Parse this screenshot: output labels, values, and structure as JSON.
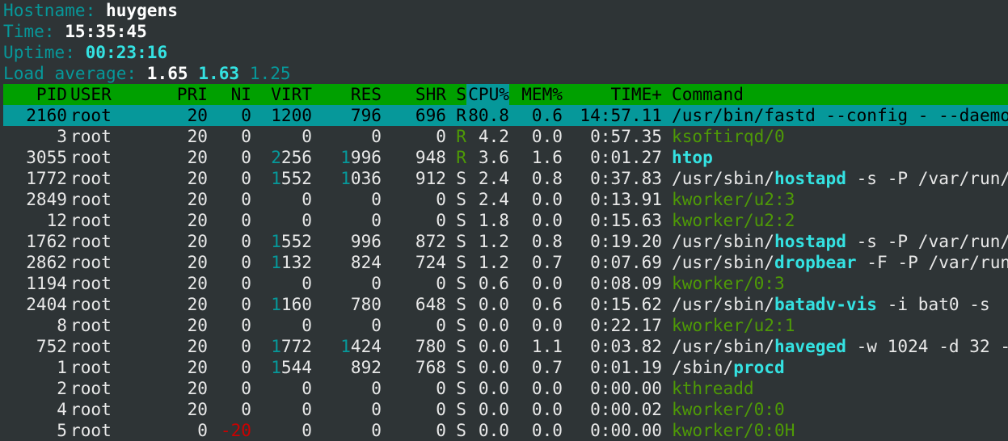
{
  "info": {
    "hostname_label": "Hostname:",
    "hostname": "huygens",
    "time_label": "Time:",
    "time": "15:35:45",
    "uptime_label": "Uptime:",
    "uptime": "00:23:16",
    "load_label": "Load average:",
    "load1": "1.65",
    "load5": "1.63",
    "load15": "1.25"
  },
  "columns": {
    "pid": "PID",
    "user": "USER",
    "pri": "PRI",
    "ni": "NI",
    "virt": "VIRT",
    "res": "RES",
    "shr": "SHR",
    "s": "S",
    "cpu": "CPU%",
    "mem": "MEM%",
    "time": "TIME+",
    "cmd": "Command"
  },
  "processes": [
    {
      "pid": "2160",
      "user": "root",
      "pri": "20",
      "ni": "0",
      "virt": "1200",
      "res": "796",
      "shr": "696",
      "s": "R",
      "cpu": "80.8",
      "mem": "0.6",
      "time": "14:57.11",
      "cmd_pre": "/usr/bin/fastd --config - --daemo",
      "cmd_bin": "",
      "cmd_post": ""
    },
    {
      "pid": "3",
      "user": "root",
      "pri": "20",
      "ni": "0",
      "virt": "0",
      "res": "0",
      "shr": "0",
      "s": "R",
      "cpu": "4.2",
      "mem": "0.0",
      "time": "0:57.35",
      "cmd_pre": "",
      "cmd_bin": "",
      "cmd_post": "",
      "kthread": "ksoftirqd/0"
    },
    {
      "pid": "3055",
      "user": "root",
      "pri": "20",
      "ni": "0",
      "virt": "2256",
      "res": "1996",
      "shr": "948",
      "s": "R",
      "cpu": "3.6",
      "mem": "1.6",
      "time": "0:01.27",
      "cmd_pre": "",
      "cmd_bin": "htop",
      "cmd_post": ""
    },
    {
      "pid": "1772",
      "user": "root",
      "pri": "20",
      "ni": "0",
      "virt": "1552",
      "res": "1036",
      "shr": "912",
      "s": "S",
      "cpu": "2.4",
      "mem": "0.8",
      "time": "0:37.83",
      "cmd_pre": "/usr/sbin/",
      "cmd_bin": "hostapd",
      "cmd_post": " -s -P /var/run/"
    },
    {
      "pid": "2849",
      "user": "root",
      "pri": "20",
      "ni": "0",
      "virt": "0",
      "res": "0",
      "shr": "0",
      "s": "S",
      "cpu": "2.4",
      "mem": "0.0",
      "time": "0:13.91",
      "kthread": "kworker/u2:3"
    },
    {
      "pid": "12",
      "user": "root",
      "pri": "20",
      "ni": "0",
      "virt": "0",
      "res": "0",
      "shr": "0",
      "s": "S",
      "cpu": "1.8",
      "mem": "0.0",
      "time": "0:15.63",
      "kthread": "kworker/u2:2"
    },
    {
      "pid": "1762",
      "user": "root",
      "pri": "20",
      "ni": "0",
      "virt": "1552",
      "res": "996",
      "shr": "872",
      "s": "S",
      "cpu": "1.2",
      "mem": "0.8",
      "time": "0:19.20",
      "cmd_pre": "/usr/sbin/",
      "cmd_bin": "hostapd",
      "cmd_post": " -s -P /var/run/"
    },
    {
      "pid": "2862",
      "user": "root",
      "pri": "20",
      "ni": "0",
      "virt": "1132",
      "res": "824",
      "shr": "724",
      "s": "S",
      "cpu": "1.2",
      "mem": "0.7",
      "time": "0:07.69",
      "cmd_pre": "/usr/sbin/",
      "cmd_bin": "dropbear",
      "cmd_post": " -F -P /var/run"
    },
    {
      "pid": "1194",
      "user": "root",
      "pri": "20",
      "ni": "0",
      "virt": "0",
      "res": "0",
      "shr": "0",
      "s": "S",
      "cpu": "0.6",
      "mem": "0.0",
      "time": "0:08.09",
      "kthread": "kworker/0:3"
    },
    {
      "pid": "2404",
      "user": "root",
      "pri": "20",
      "ni": "0",
      "virt": "1160",
      "res": "780",
      "shr": "648",
      "s": "S",
      "cpu": "0.0",
      "mem": "0.6",
      "time": "0:15.62",
      "cmd_pre": "/usr/sbin/",
      "cmd_bin": "batadv-vis",
      "cmd_post": " -i bat0 -s"
    },
    {
      "pid": "8",
      "user": "root",
      "pri": "20",
      "ni": "0",
      "virt": "0",
      "res": "0",
      "shr": "0",
      "s": "S",
      "cpu": "0.0",
      "mem": "0.0",
      "time": "0:22.17",
      "kthread": "kworker/u2:1"
    },
    {
      "pid": "752",
      "user": "root",
      "pri": "20",
      "ni": "0",
      "virt": "1772",
      "res": "1424",
      "shr": "780",
      "s": "S",
      "cpu": "0.0",
      "mem": "1.1",
      "time": "0:03.82",
      "cmd_pre": "/usr/sbin/",
      "cmd_bin": "haveged",
      "cmd_post": " -w 1024 -d 32 -"
    },
    {
      "pid": "1",
      "user": "root",
      "pri": "20",
      "ni": "0",
      "virt": "1544",
      "res": "892",
      "shr": "768",
      "s": "S",
      "cpu": "0.0",
      "mem": "0.7",
      "time": "0:01.19",
      "cmd_pre": "/sbin/",
      "cmd_bin": "procd",
      "cmd_post": ""
    },
    {
      "pid": "2",
      "user": "root",
      "pri": "20",
      "ni": "0",
      "virt": "0",
      "res": "0",
      "shr": "0",
      "s": "S",
      "cpu": "0.0",
      "mem": "0.0",
      "time": "0:00.00",
      "kthread": "kthreadd"
    },
    {
      "pid": "4",
      "user": "root",
      "pri": "20",
      "ni": "0",
      "virt": "0",
      "res": "0",
      "shr": "0",
      "s": "S",
      "cpu": "0.0",
      "mem": "0.0",
      "time": "0:00.02",
      "kthread": "kworker/0:0"
    },
    {
      "pid": "5",
      "user": "root",
      "pri": "0",
      "ni": "-20",
      "virt": "0",
      "res": "0",
      "shr": "0",
      "s": "S",
      "cpu": "0.0",
      "mem": "0.0",
      "time": "0:00.00",
      "kthread": "kworker/0:0H"
    }
  ],
  "colors": {
    "background": "#2e3436",
    "header_bar": "#00a000",
    "selected_row": "#06989a",
    "label_cyan": "#06989a",
    "bright_cyan": "#34e2e2",
    "kthread_green": "#4e9a06",
    "negative_red": "#cc0000"
  }
}
